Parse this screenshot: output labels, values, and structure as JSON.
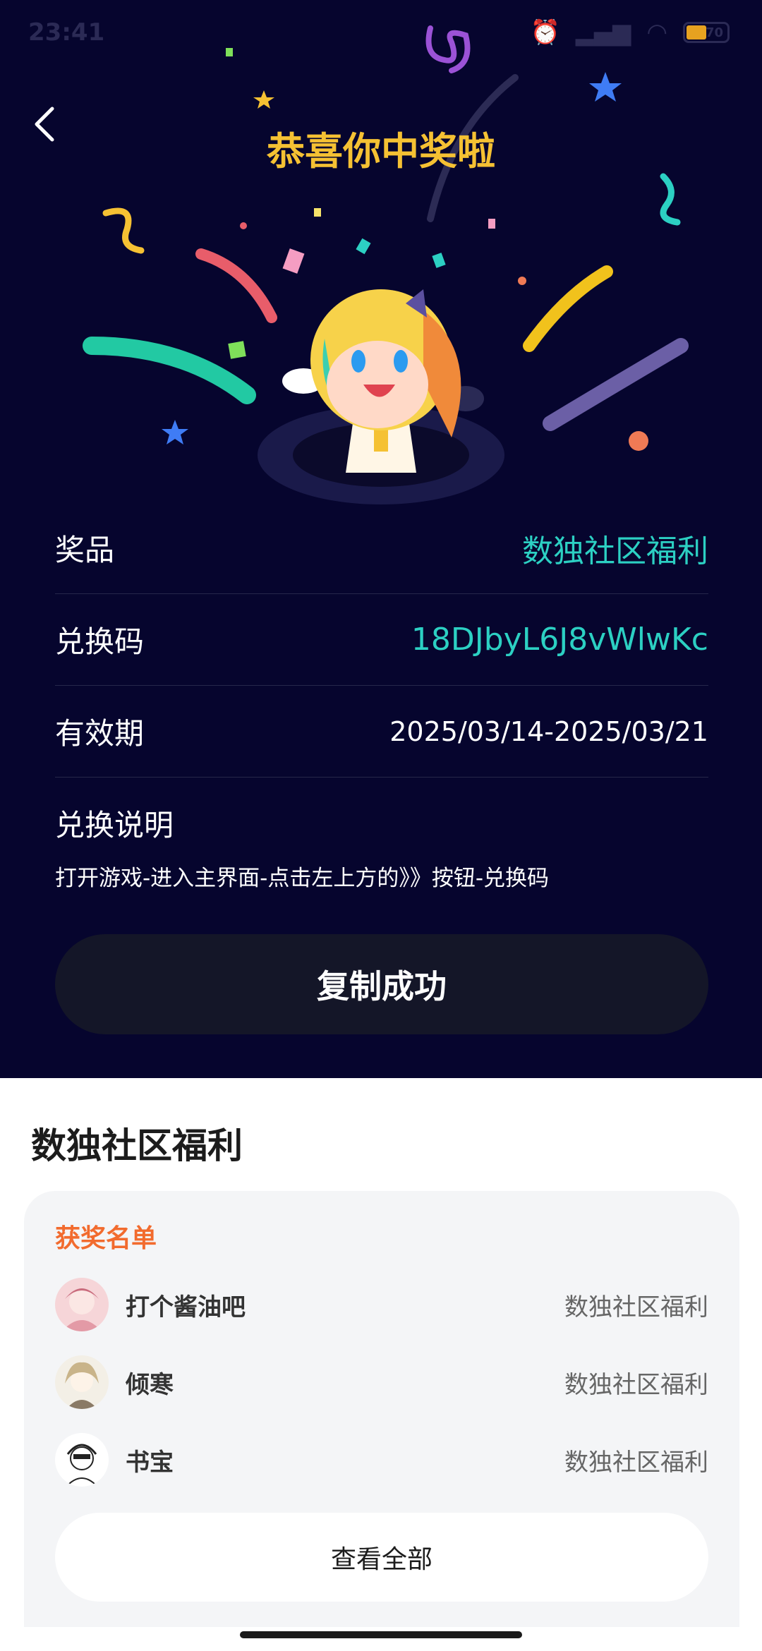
{
  "status_bar": {
    "time": "23:41",
    "battery": "70"
  },
  "header": {
    "title": "恭喜你中奖啦"
  },
  "prize": {
    "prize_label": "奖品",
    "prize_value": "数独社区福利",
    "code_label": "兑换码",
    "code_value": "18DJbyL6J8vWlwKc",
    "validity_label": "有效期",
    "validity_value": "2025/03/14-2025/03/21",
    "instructions_label": "兑换说明",
    "instructions_text": "打开游戏-进入主界面-点击左上方的》》按钮-兑换码"
  },
  "copy_button": "复制成功",
  "section": {
    "title": "数独社区福利",
    "winners_title": "获奖名单",
    "winners": [
      {
        "name": "打个酱油吧",
        "prize": "数独社区福利"
      },
      {
        "name": "倾寒",
        "prize": "数独社区福利"
      },
      {
        "name": "书宝",
        "prize": "数独社区福利"
      }
    ],
    "view_all": "查看全部"
  },
  "colors": {
    "background_dark": "#06052e",
    "title_gold": "#f5c133",
    "accent_teal": "#2cd0c3",
    "winners_orange": "#f26b2e"
  },
  "icons": [
    "back-arrow-icon",
    "alarm-icon",
    "signal-icon",
    "wifi-icon",
    "battery-icon"
  ]
}
